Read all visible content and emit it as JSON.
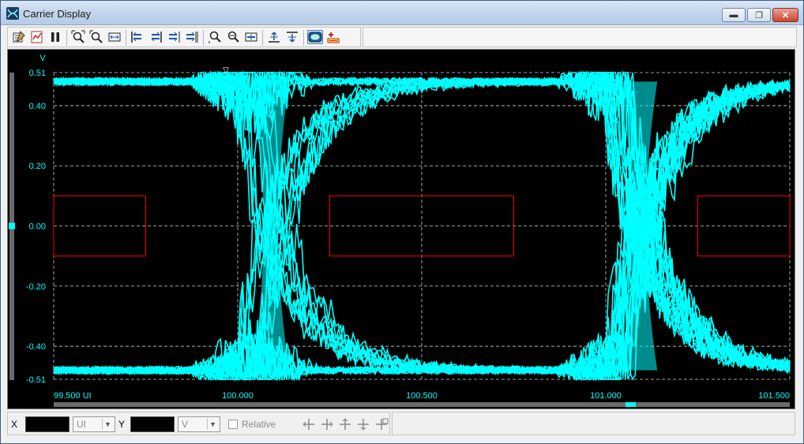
{
  "window": {
    "title": "Carrier Display"
  },
  "window_controls": {
    "minimize": "▬",
    "maximize": "❐",
    "close": "✕"
  },
  "toolbar": {
    "groups": [
      [
        "edit-properties-icon",
        "export-icon",
        "pause-icon"
      ],
      [
        "zoom-fit-icon",
        "zoom-box-icon",
        "zoom-horizontal-icon"
      ],
      [
        "shift-left-icon",
        "shift-right-icon",
        "step-right-icon",
        "step-end-icon"
      ],
      [
        "zoom-x-in-icon",
        "zoom-x-out-icon",
        "center-icon"
      ],
      [
        "align-up-icon",
        "align-down-icon"
      ],
      [
        "eye-mask-icon",
        "add-mask-icon"
      ]
    ]
  },
  "plot": {
    "y_unit": "V",
    "trigger_marker": "▽",
    "background": "#000000",
    "trace_color": "#00ffff",
    "mask_color": "#ff0000",
    "grid_color": "#cfcfcf",
    "axis_text_color": "#00ffff"
  },
  "chart_data": {
    "type": "eye-diagram",
    "xlabel": "UI",
    "ylabel": "V",
    "xlim": [
      99.5,
      101.5
    ],
    "ylim": [
      -0.51,
      0.51
    ],
    "x_ticks": [
      "99.500 UI",
      "100.000",
      "100.500",
      "101.000",
      "101.500"
    ],
    "y_ticks": [
      "0.51",
      "0.40",
      "0.20",
      "0.00",
      "-0.20",
      "-0.40",
      "-0.51"
    ],
    "y_tick_values": [
      0.51,
      0.4,
      0.2,
      0.0,
      -0.2,
      -0.4,
      -0.51
    ],
    "x_tick_values": [
      99.5,
      100.0,
      100.5,
      101.0,
      101.5
    ],
    "high_level": 0.48,
    "low_level": -0.48,
    "crossings": [
      100.05,
      101.05
    ],
    "masks": [
      {
        "name": "left-mask",
        "x": [
          99.5,
          99.75
        ],
        "y": [
          -0.1,
          0.1
        ]
      },
      {
        "name": "center-mask",
        "x": [
          100.25,
          100.75
        ],
        "y": [
          -0.1,
          0.1
        ]
      },
      {
        "name": "right-mask",
        "x": [
          101.25,
          101.5
        ],
        "y": [
          -0.1,
          0.1
        ]
      }
    ]
  },
  "statusbar": {
    "x_label": "X",
    "x_value": "",
    "x_unit": "UI",
    "y_label": "Y",
    "y_value": "",
    "y_unit": "V",
    "relative_label": "Relative",
    "icons": [
      "pan-left-icon",
      "pan-right-icon",
      "pan-up-icon",
      "pan-down-icon",
      "pan-reset-icon"
    ]
  }
}
